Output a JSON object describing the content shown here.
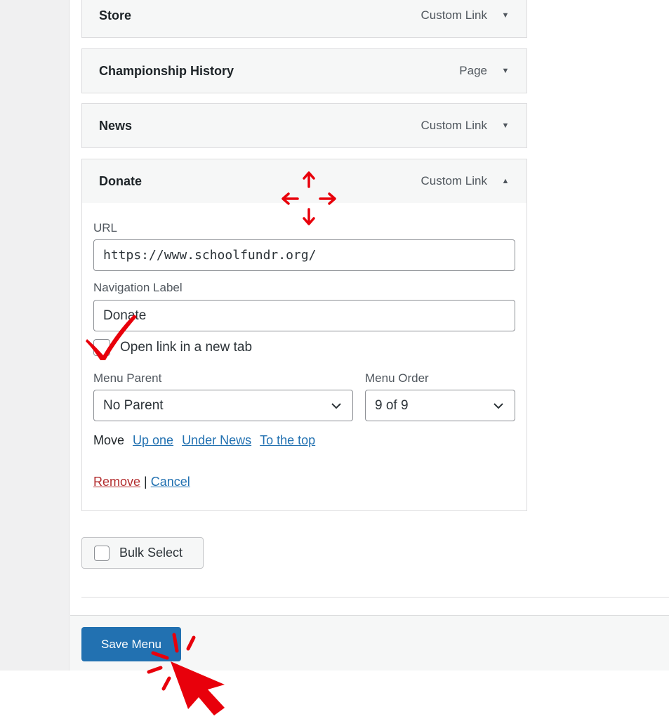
{
  "menu_items": [
    {
      "title": "Store",
      "type": "Custom Link",
      "arrow": "▼"
    },
    {
      "title": "Championship History",
      "type": "Page",
      "arrow": "▼"
    },
    {
      "title": "News",
      "type": "Custom Link",
      "arrow": "▼"
    },
    {
      "title": "Donate",
      "type": "Custom Link",
      "arrow": "▲"
    }
  ],
  "item_settings": {
    "url_label": "URL",
    "url_value": "https://www.schoolfundr.org/",
    "nav_label_label": "Navigation Label",
    "nav_label_value": "Donate",
    "new_tab_label": "Open link in a new tab",
    "menu_parent_label": "Menu Parent",
    "menu_parent_value": "No Parent",
    "menu_order_label": "Menu Order",
    "menu_order_value": "9 of 9",
    "move_label": "Move",
    "move_links": [
      "Up one",
      "Under News",
      "To the top"
    ],
    "remove_label": "Remove",
    "separator": "|",
    "cancel_label": "Cancel"
  },
  "bulk_select_label": "Bulk Select",
  "save_menu_label": "Save Menu",
  "colors": {
    "primary": "#2271b1",
    "danger": "#b32d2e",
    "annotation": "#e8000b"
  },
  "icons": [
    "move-arrows-icon",
    "checkmark-annotation-icon",
    "cursor-click-icon",
    "chevron-down-icon"
  ]
}
